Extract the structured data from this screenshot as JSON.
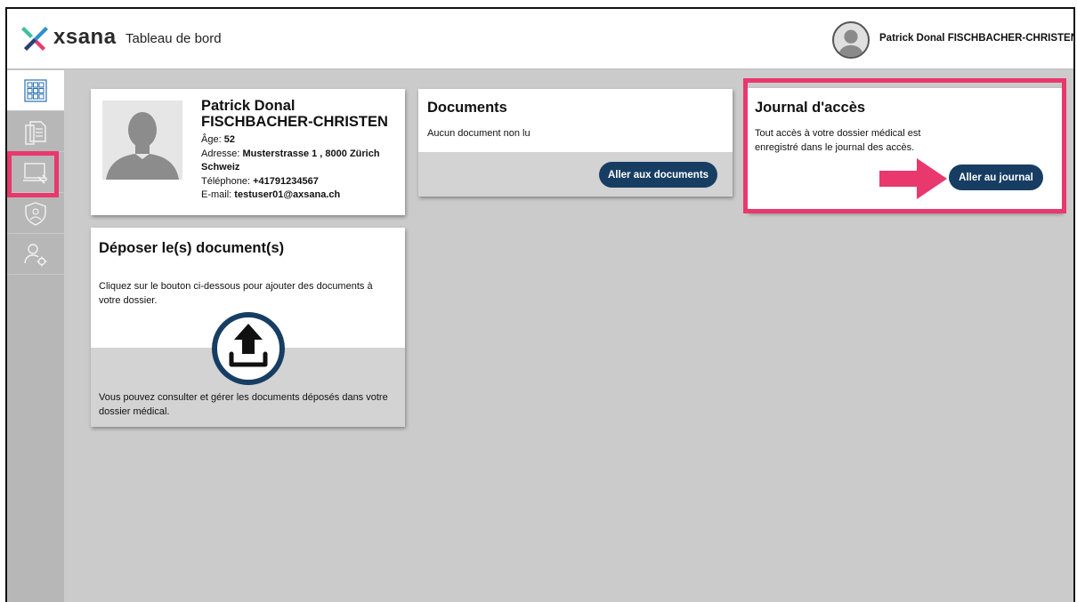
{
  "header": {
    "brand": "xsana",
    "title": "Tableau de bord",
    "user_name": "Patrick Donal FISCHBACHER-CHRISTEN"
  },
  "sidebar": {
    "items": [
      {
        "name": "dashboard",
        "icon": "grid-icon"
      },
      {
        "name": "documents",
        "icon": "documents-icon"
      },
      {
        "name": "access-journal",
        "icon": "monitor-tools-icon"
      },
      {
        "name": "privacy",
        "icon": "shield-person-icon"
      },
      {
        "name": "settings",
        "icon": "user-gear-icon"
      }
    ]
  },
  "profile": {
    "name": "Patrick Donal FISCHBACHER-CHRISTEN",
    "age_label": "Âge:",
    "age": "52",
    "address_label": "Adresse:",
    "address": "Musterstrasse 1 , 8000 Zürich",
    "country": "Schweiz",
    "phone_label": "Téléphone:",
    "phone": "+41791234567",
    "email_label": "E-mail:",
    "email": "testuser01@axsana.ch"
  },
  "documents": {
    "title": "Documents",
    "status": "Aucun document non lu",
    "button": "Aller aux documents"
  },
  "journal": {
    "title": "Journal d'accès",
    "description": "Tout accès à votre dossier médical est enregistré dans le journal des accès.",
    "button": "Aller au journal"
  },
  "upload": {
    "title": "Déposer le(s) document(s)",
    "description": "Cliquez sur le bouton ci-dessous pour ajouter des documents à votre dossier.",
    "footer": "Vous pouvez consulter et gérer les documents déposés dans votre dossier médical."
  },
  "colors": {
    "primary": "#173d63",
    "highlight": "#e8386d",
    "background": "#cbcbcb",
    "logo_green": "#3fbf9c",
    "logo_pink": "#e83a6b"
  }
}
